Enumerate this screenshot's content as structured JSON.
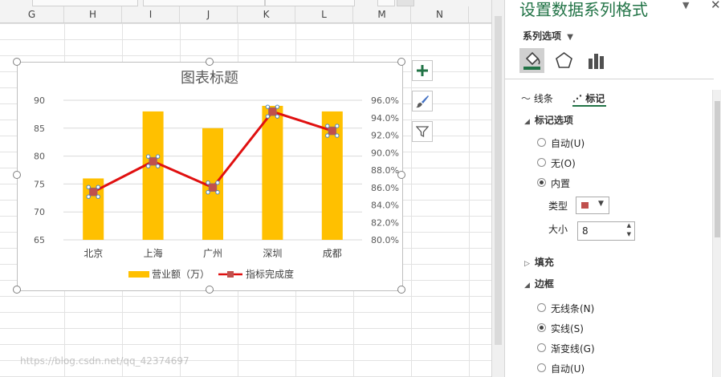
{
  "sheet": {
    "columns": [
      "G",
      "H",
      "I",
      "J",
      "K",
      "L",
      "M",
      "N"
    ]
  },
  "chart_buttons": {
    "add_element_icon": "plus-icon",
    "style_icon": "brush-icon",
    "filter_icon": "funnel-icon"
  },
  "chart_data": {
    "type": "bar",
    "title": "图表标题",
    "categories": [
      "北京",
      "上海",
      "广州",
      "深圳",
      "成都"
    ],
    "series": [
      {
        "name": "营业额（万）",
        "type": "bar",
        "axis": "left",
        "color": "#FFC000",
        "values": [
          76,
          88,
          85,
          89,
          88
        ]
      },
      {
        "name": "指标完成度",
        "type": "line",
        "axis": "right",
        "color": "#E01010",
        "marker_color": "#C0504D",
        "values": [
          0.855,
          0.89,
          0.86,
          0.947,
          0.925
        ]
      }
    ],
    "y_left": {
      "ticks": [
        "65",
        "70",
        "75",
        "80",
        "85",
        "90"
      ],
      "min": 65,
      "max": 90
    },
    "y_right": {
      "ticks": [
        "80.0%",
        "82.0%",
        "84.0%",
        "86.0%",
        "88.0%",
        "90.0%",
        "92.0%",
        "94.0%",
        "96.0%"
      ],
      "min": 0.8,
      "max": 0.96
    },
    "gridlines": true,
    "legend_position": "bottom"
  },
  "panel": {
    "title": "设置数据系列格式",
    "series_options_label": "系列选项",
    "tabs": {
      "line": "线条",
      "marker": "标记"
    },
    "marker_options": {
      "header": "标记选项",
      "auto": "自动(U)",
      "none": "无(O)",
      "builtin": "内置",
      "type_label": "类型",
      "size_label": "大小",
      "size_value": "8",
      "marker_swatch_color": "#C0504D"
    },
    "fill_header": "填充",
    "border": {
      "header": "边框",
      "no_line": "无线条(N)",
      "solid": "实线(S)",
      "gradient": "渐变线(G)",
      "auto": "自动(U)"
    },
    "accent_color": "#217346"
  },
  "watermark": "https://blog.csdn.net/qq_42374697"
}
